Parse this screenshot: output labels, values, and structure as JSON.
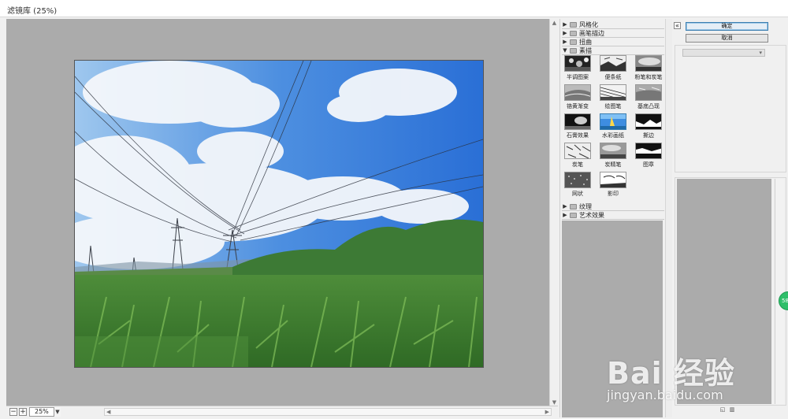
{
  "window": {
    "title": "滤镜库 (25%)"
  },
  "preview": {
    "zoom_value": "25%"
  },
  "filter_groups": [
    {
      "label": "风格化",
      "expanded": false
    },
    {
      "label": "画笔描边",
      "expanded": false
    },
    {
      "label": "扭曲",
      "expanded": false
    },
    {
      "label": "素描",
      "expanded": true
    },
    {
      "label": "纹理",
      "expanded": false
    },
    {
      "label": "艺术效果",
      "expanded": false
    }
  ],
  "sketch_filters": [
    {
      "label": "半调图案",
      "selected": false
    },
    {
      "label": "便条纸",
      "selected": false
    },
    {
      "label": "粉笔和炭笔",
      "selected": false
    },
    {
      "label": "铬黄渐变",
      "selected": false
    },
    {
      "label": "绘图笔",
      "selected": false
    },
    {
      "label": "基底凸现",
      "selected": false
    },
    {
      "label": "石膏效果",
      "selected": false
    },
    {
      "label": "水彩画纸",
      "selected": true
    },
    {
      "label": "撕边",
      "selected": false
    },
    {
      "label": "炭笔",
      "selected": false
    },
    {
      "label": "炭精笔",
      "selected": false
    },
    {
      "label": "图章",
      "selected": false
    },
    {
      "label": "网状",
      "selected": false
    },
    {
      "label": "影印",
      "selected": false
    }
  ],
  "actions": {
    "ok_label": "确定",
    "cancel_label": "取消"
  },
  "badge": {
    "text": "58"
  },
  "watermark": {
    "brand": "Bai 经验",
    "url": "jingyan.baidu.com"
  },
  "colors": {
    "canvas_gray": "#ababab",
    "primary_border": "#3c7fb1"
  }
}
